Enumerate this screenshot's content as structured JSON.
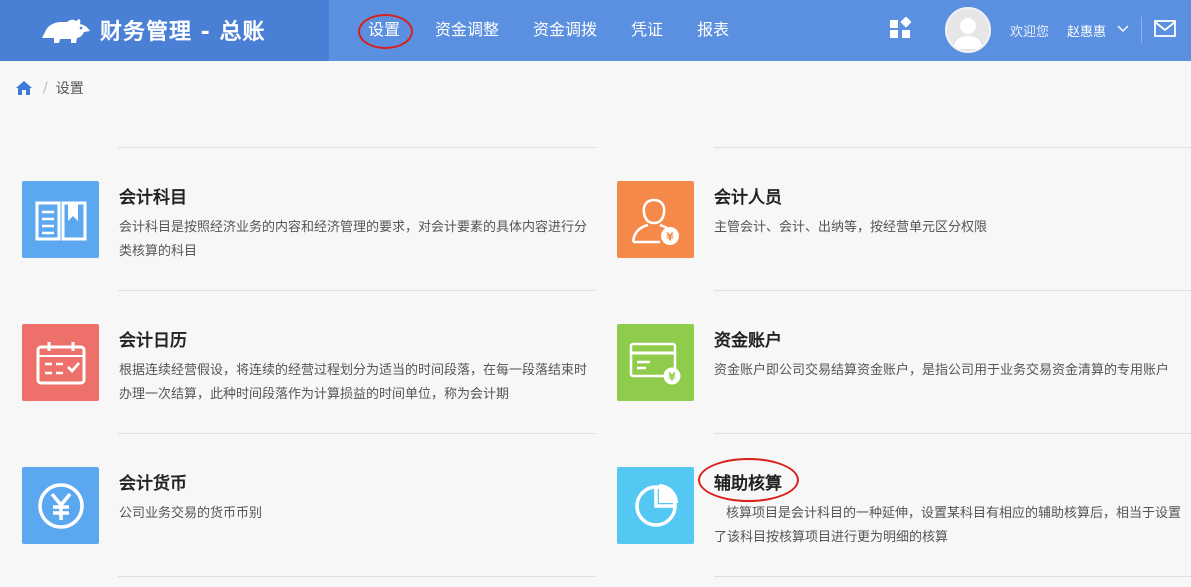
{
  "brand": {
    "title": "财务管理 - 总账"
  },
  "nav": [
    {
      "label": "设置"
    },
    {
      "label": "资金调整"
    },
    {
      "label": "资金调拨"
    },
    {
      "label": "凭证"
    },
    {
      "label": "报表"
    }
  ],
  "header": {
    "welcome": "欢迎您",
    "username": "赵惠惠"
  },
  "breadcrumb": {
    "current": "设置"
  },
  "colors": {
    "topbar": "#5b8fe0",
    "brand": "#4a7fd6",
    "blue_tile": "#5ca8f0",
    "orange_tile": "#f5894a",
    "red_tile": "#ee706a",
    "green_tile": "#8fcc4c",
    "cyan_tile": "#54c7f2",
    "annotation": "#d9201a"
  },
  "cards": [
    {
      "title": "会计科目",
      "desc": "会计科目是按照经济业务的内容和经济管理的要求，对会计要素的具体内容进行分类核算的科目",
      "icon": "book-icon"
    },
    {
      "title": "会计人员",
      "desc": "主管会计、会计、出纳等，按经营单元区分权限",
      "icon": "accountant-icon"
    },
    {
      "title": "会计日历",
      "desc": "根据连续经营假设，将连续的经营过程划分为适当的时间段落，在每一段落结束时办理一次结算，此种时间段落作为计算损益的时间单位，称为会计期",
      "icon": "calendar-icon"
    },
    {
      "title": "资金账户",
      "desc": "资金账户即公司交易结算资金账户，是指公司用于业务交易资金清算的专用账户",
      "icon": "bank-card-icon"
    },
    {
      "title": "会计货币",
      "desc": "公司业务交易的货币币别",
      "icon": "yen-icon"
    },
    {
      "title": "辅助核算",
      "desc": "核算项目是会计科目的一种延伸，设置某科目有相应的辅助核算后，相当于设置了该科目按核算项目进行更为明细的核算",
      "icon": "pie-chart-icon"
    }
  ]
}
